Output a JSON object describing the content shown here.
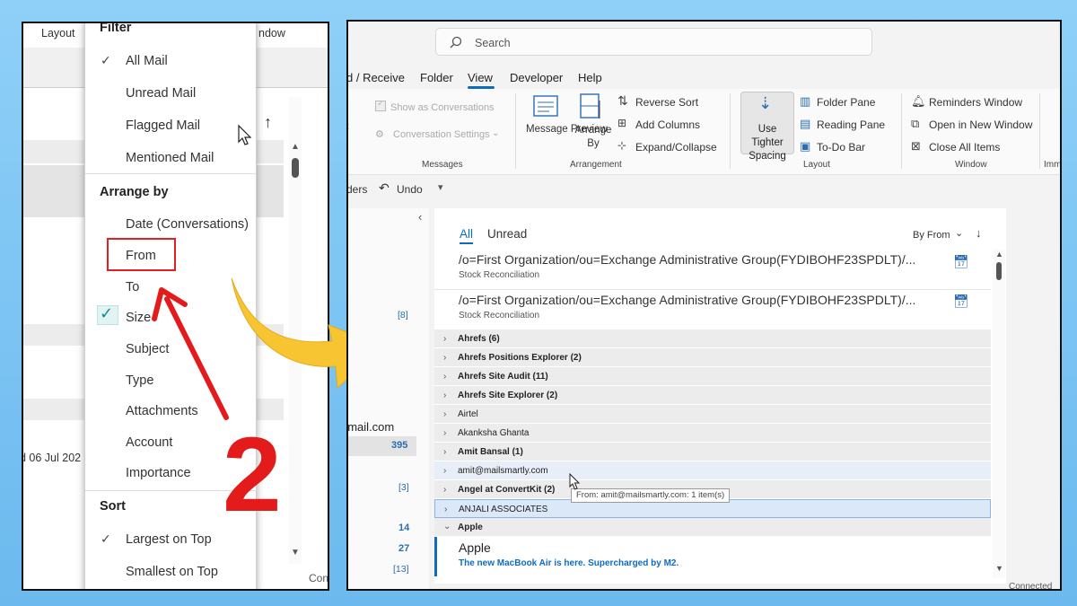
{
  "left_panel": {
    "tabs": [
      "Layout",
      "ndow"
    ],
    "date_fragment": "d 06 Jul 202",
    "status": "Con",
    "up_arrow": "↑",
    "menu": {
      "filter_header": "Filter",
      "filter_items": [
        "All Mail",
        "Unread Mail",
        "Flagged Mail",
        "Mentioned Mail"
      ],
      "arrange_header": "Arrange by",
      "arrange_items": [
        "Date (Conversations)",
        "From",
        "To",
        "Size",
        "Subject",
        "Type",
        "Attachments",
        "Account",
        "Importance"
      ],
      "sort_header": "Sort",
      "sort_items": [
        "Largest on Top",
        "Smallest on Top"
      ]
    }
  },
  "step_number": "2",
  "right_panel": {
    "search_placeholder": "Search",
    "ribbon_tabs": [
      "d / Receive",
      "Folder",
      "View",
      "Developer",
      "Help"
    ],
    "active_tab": "View",
    "messages_group": {
      "show_conversations": "Show as Conversations",
      "conversation_settings": "Conversation Settings",
      "label": "Messages"
    },
    "arrangement_group": {
      "message_preview": "Message Preview",
      "arrange_by": "Arrange By",
      "reverse_sort": "Reverse Sort",
      "add_columns": "Add Columns",
      "expand_collapse": "Expand/Collapse",
      "label": "Arrangement"
    },
    "layout_group": {
      "use_tighter": "Use Tighter Spacing",
      "folder_pane": "Folder Pane",
      "reading_pane": "Reading Pane",
      "todo_bar": "To-Do Bar",
      "label": "Layout"
    },
    "window_group": {
      "reminders": "Reminders Window",
      "open_new": "Open in New Window",
      "close_all": "Close All Items",
      "label": "Window"
    },
    "imm": "Imm",
    "qat": {
      "ders": "ders",
      "undo": "Undo"
    },
    "folder_counts": [
      "[8]",
      "gmail.com",
      "395",
      "[3]",
      "14",
      "27",
      "[13]"
    ],
    "filters": {
      "all": "All",
      "unread": "Unread",
      "by_from": "By From"
    },
    "messages": [
      {
        "from": "/o=First Organization/ou=Exchange Administrative Group(FYDIBOHF23SPDLT)/...",
        "subject": "Stock Reconciliation"
      },
      {
        "from": "/o=First Organization/ou=Exchange Administrative Group(FYDIBOHF23SPDLT)/...",
        "subject": "Stock Reconciliation"
      }
    ],
    "groups": [
      {
        "label": "Ahrefs (6)",
        "bold": true
      },
      {
        "label": "Ahrefs Positions Explorer (2)",
        "bold": true
      },
      {
        "label": "Ahrefs Site Audit (11)",
        "bold": true
      },
      {
        "label": "Ahrefs Site Explorer (2)",
        "bold": true
      },
      {
        "label": "Airtel",
        "bold": false
      },
      {
        "label": "Akanksha Ghanta",
        "bold": false
      },
      {
        "label": "Amit Bansal (1)",
        "bold": true
      },
      {
        "label": "amit@mailsmartly.com",
        "bold": false
      },
      {
        "label": "Angel at ConvertKit (2)",
        "bold": true
      },
      {
        "label": "ANJALI ASSOCIATES",
        "bold": false
      },
      {
        "label": "Apple",
        "bold": true
      }
    ],
    "tooltip": "From: amit@mailsmartly.com: 1 item(s)",
    "apple_message": {
      "from": "Apple",
      "subject": "The new MacBook Air is here. Supercharged by M2."
    },
    "status": "Connected"
  }
}
